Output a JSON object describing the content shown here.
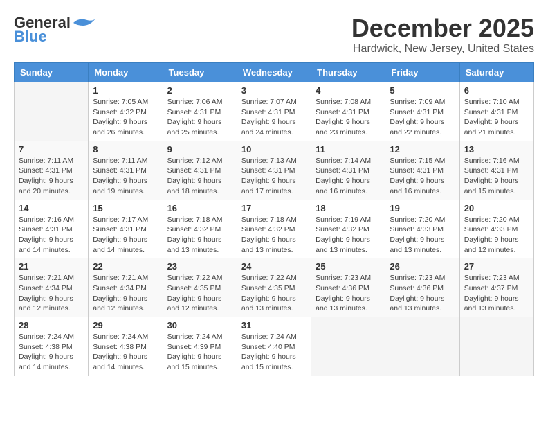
{
  "header": {
    "logo_line1": "General",
    "logo_line2": "Blue",
    "month": "December 2025",
    "location": "Hardwick, New Jersey, United States"
  },
  "days_of_week": [
    "Sunday",
    "Monday",
    "Tuesday",
    "Wednesday",
    "Thursday",
    "Friday",
    "Saturday"
  ],
  "weeks": [
    [
      {
        "day": "",
        "info": ""
      },
      {
        "day": "1",
        "info": "Sunrise: 7:05 AM\nSunset: 4:32 PM\nDaylight: 9 hours\nand 26 minutes."
      },
      {
        "day": "2",
        "info": "Sunrise: 7:06 AM\nSunset: 4:31 PM\nDaylight: 9 hours\nand 25 minutes."
      },
      {
        "day": "3",
        "info": "Sunrise: 7:07 AM\nSunset: 4:31 PM\nDaylight: 9 hours\nand 24 minutes."
      },
      {
        "day": "4",
        "info": "Sunrise: 7:08 AM\nSunset: 4:31 PM\nDaylight: 9 hours\nand 23 minutes."
      },
      {
        "day": "5",
        "info": "Sunrise: 7:09 AM\nSunset: 4:31 PM\nDaylight: 9 hours\nand 22 minutes."
      },
      {
        "day": "6",
        "info": "Sunrise: 7:10 AM\nSunset: 4:31 PM\nDaylight: 9 hours\nand 21 minutes."
      }
    ],
    [
      {
        "day": "7",
        "info": "Sunrise: 7:11 AM\nSunset: 4:31 PM\nDaylight: 9 hours\nand 20 minutes."
      },
      {
        "day": "8",
        "info": "Sunrise: 7:11 AM\nSunset: 4:31 PM\nDaylight: 9 hours\nand 19 minutes."
      },
      {
        "day": "9",
        "info": "Sunrise: 7:12 AM\nSunset: 4:31 PM\nDaylight: 9 hours\nand 18 minutes."
      },
      {
        "day": "10",
        "info": "Sunrise: 7:13 AM\nSunset: 4:31 PM\nDaylight: 9 hours\nand 17 minutes."
      },
      {
        "day": "11",
        "info": "Sunrise: 7:14 AM\nSunset: 4:31 PM\nDaylight: 9 hours\nand 16 minutes."
      },
      {
        "day": "12",
        "info": "Sunrise: 7:15 AM\nSunset: 4:31 PM\nDaylight: 9 hours\nand 16 minutes."
      },
      {
        "day": "13",
        "info": "Sunrise: 7:16 AM\nSunset: 4:31 PM\nDaylight: 9 hours\nand 15 minutes."
      }
    ],
    [
      {
        "day": "14",
        "info": "Sunrise: 7:16 AM\nSunset: 4:31 PM\nDaylight: 9 hours\nand 14 minutes."
      },
      {
        "day": "15",
        "info": "Sunrise: 7:17 AM\nSunset: 4:31 PM\nDaylight: 9 hours\nand 14 minutes."
      },
      {
        "day": "16",
        "info": "Sunrise: 7:18 AM\nSunset: 4:32 PM\nDaylight: 9 hours\nand 13 minutes."
      },
      {
        "day": "17",
        "info": "Sunrise: 7:18 AM\nSunset: 4:32 PM\nDaylight: 9 hours\nand 13 minutes."
      },
      {
        "day": "18",
        "info": "Sunrise: 7:19 AM\nSunset: 4:32 PM\nDaylight: 9 hours\nand 13 minutes."
      },
      {
        "day": "19",
        "info": "Sunrise: 7:20 AM\nSunset: 4:33 PM\nDaylight: 9 hours\nand 13 minutes."
      },
      {
        "day": "20",
        "info": "Sunrise: 7:20 AM\nSunset: 4:33 PM\nDaylight: 9 hours\nand 12 minutes."
      }
    ],
    [
      {
        "day": "21",
        "info": "Sunrise: 7:21 AM\nSunset: 4:34 PM\nDaylight: 9 hours\nand 12 minutes."
      },
      {
        "day": "22",
        "info": "Sunrise: 7:21 AM\nSunset: 4:34 PM\nDaylight: 9 hours\nand 12 minutes."
      },
      {
        "day": "23",
        "info": "Sunrise: 7:22 AM\nSunset: 4:35 PM\nDaylight: 9 hours\nand 12 minutes."
      },
      {
        "day": "24",
        "info": "Sunrise: 7:22 AM\nSunset: 4:35 PM\nDaylight: 9 hours\nand 13 minutes."
      },
      {
        "day": "25",
        "info": "Sunrise: 7:23 AM\nSunset: 4:36 PM\nDaylight: 9 hours\nand 13 minutes."
      },
      {
        "day": "26",
        "info": "Sunrise: 7:23 AM\nSunset: 4:36 PM\nDaylight: 9 hours\nand 13 minutes."
      },
      {
        "day": "27",
        "info": "Sunrise: 7:23 AM\nSunset: 4:37 PM\nDaylight: 9 hours\nand 13 minutes."
      }
    ],
    [
      {
        "day": "28",
        "info": "Sunrise: 7:24 AM\nSunset: 4:38 PM\nDaylight: 9 hours\nand 14 minutes."
      },
      {
        "day": "29",
        "info": "Sunrise: 7:24 AM\nSunset: 4:38 PM\nDaylight: 9 hours\nand 14 minutes."
      },
      {
        "day": "30",
        "info": "Sunrise: 7:24 AM\nSunset: 4:39 PM\nDaylight: 9 hours\nand 15 minutes."
      },
      {
        "day": "31",
        "info": "Sunrise: 7:24 AM\nSunset: 4:40 PM\nDaylight: 9 hours\nand 15 minutes."
      },
      {
        "day": "",
        "info": ""
      },
      {
        "day": "",
        "info": ""
      },
      {
        "day": "",
        "info": ""
      }
    ]
  ]
}
